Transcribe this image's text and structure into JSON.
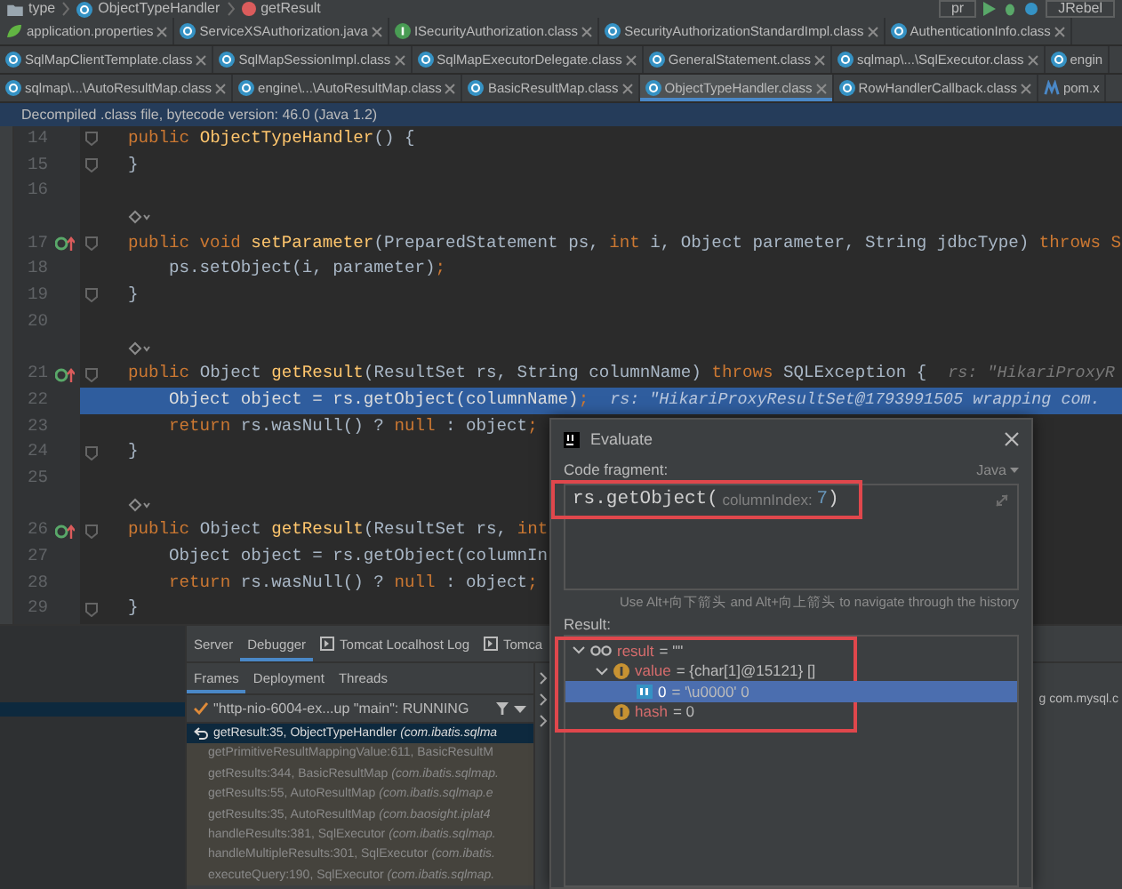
{
  "breadcrumb": [
    {
      "label": "type",
      "kind": "package"
    },
    {
      "label": "ObjectTypeHandler",
      "kind": "class"
    },
    {
      "label": "getResult",
      "kind": "method"
    }
  ],
  "toolbar": {
    "run_config": "pr",
    "plugin": "JRebel"
  },
  "editor_tabs": [
    [
      {
        "label": "application.properties",
        "kind": "properties",
        "selected": false,
        "closable": true
      },
      {
        "label": "ServiceXSAuthorization.java",
        "kind": "class",
        "selected": false,
        "closable": true
      },
      {
        "label": "ISecurityAuthorization.class",
        "kind": "interface",
        "selected": false,
        "closable": true
      },
      {
        "label": "SecurityAuthorizationStandardImpl.class",
        "kind": "class",
        "selected": false,
        "closable": true
      },
      {
        "label": "AuthenticationInfo.class",
        "kind": "class",
        "selected": false,
        "closable": true
      }
    ],
    [
      {
        "label": "SqlMapClientTemplate.class",
        "kind": "class",
        "selected": false,
        "closable": true
      },
      {
        "label": "SqlMapSessionImpl.class",
        "kind": "class",
        "selected": false,
        "closable": true
      },
      {
        "label": "SqlMapExecutorDelegate.class",
        "kind": "class",
        "selected": false,
        "closable": true
      },
      {
        "label": "GeneralStatement.class",
        "kind": "class",
        "selected": false,
        "closable": true
      },
      {
        "label": "sqlmap\\...\\SqlExecutor.class",
        "kind": "class",
        "selected": false,
        "closable": true
      },
      {
        "label": "engin",
        "kind": "class",
        "selected": false,
        "closable": false
      }
    ],
    [
      {
        "label": "sqlmap\\...\\AutoResultMap.class",
        "kind": "class",
        "selected": false,
        "closable": true
      },
      {
        "label": "engine\\...\\AutoResultMap.class",
        "kind": "class",
        "selected": false,
        "closable": true
      },
      {
        "label": "BasicResultMap.class",
        "kind": "class",
        "selected": false,
        "closable": true
      },
      {
        "label": "ObjectTypeHandler.class",
        "kind": "class",
        "selected": true,
        "closable": true
      },
      {
        "label": "RowHandlerCallback.class",
        "kind": "class",
        "selected": false,
        "closable": true
      },
      {
        "label": "pom.x",
        "kind": "maven",
        "selected": false,
        "closable": false
      }
    ]
  ],
  "banner": "Decompiled .class file, bytecode version: 46.0 (Java 1.2)",
  "code_lines": [
    {
      "kind": "code",
      "number": "14",
      "override": false,
      "fold": true,
      "current": false,
      "tokens": [
        {
          "text": "public ",
          "kind": "kw"
        },
        {
          "text": "ObjectTypeHandler",
          "kind": "fn"
        },
        {
          "text": "() {",
          "kind": "text"
        }
      ]
    },
    {
      "kind": "code",
      "number": "15",
      "override": false,
      "fold": true,
      "current": false,
      "tokens": [
        {
          "text": "}",
          "kind": "text"
        }
      ]
    },
    {
      "kind": "code",
      "number": "16",
      "override": false,
      "fold": false,
      "current": false
    },
    {
      "kind": "hint"
    },
    {
      "kind": "code",
      "number": "17",
      "override": true,
      "fold": true,
      "current": false,
      "tokens": [
        {
          "text": "public void ",
          "kind": "kw"
        },
        {
          "text": "setParameter",
          "kind": "fn"
        },
        {
          "text": "(PreparedStatement ps, ",
          "kind": "text"
        },
        {
          "text": "int ",
          "kind": "kw"
        },
        {
          "text": "i, Object parameter, String jdbcType) ",
          "kind": "text"
        },
        {
          "text": "throws S",
          "kind": "kw"
        }
      ]
    },
    {
      "kind": "code",
      "number": "18",
      "override": false,
      "fold": false,
      "current": false,
      "tokens": [
        {
          "text": "    ps.setObject(i, parameter)",
          "kind": "text"
        },
        {
          "text": ";",
          "kind": "kw"
        }
      ]
    },
    {
      "kind": "code",
      "number": "19",
      "override": false,
      "fold": true,
      "current": false,
      "tokens": [
        {
          "text": "}",
          "kind": "text"
        }
      ]
    },
    {
      "kind": "code",
      "number": "20",
      "override": false,
      "fold": false,
      "current": false
    },
    {
      "kind": "hint"
    },
    {
      "kind": "code",
      "number": "21",
      "override": true,
      "fold": true,
      "current": false,
      "tokens": [
        {
          "text": "public ",
          "kind": "kw"
        },
        {
          "text": "Object ",
          "kind": "text"
        },
        {
          "text": "getResult",
          "kind": "fn"
        },
        {
          "text": "(ResultSet rs, String columnName) ",
          "kind": "text"
        },
        {
          "text": "throws ",
          "kind": "kw"
        },
        {
          "text": "SQLException {",
          "kind": "text"
        }
      ],
      "inline_value": "rs: \"HikariProxyR"
    },
    {
      "kind": "code",
      "number": "22",
      "override": false,
      "fold": false,
      "current": true,
      "tokens": [
        {
          "text": "    Object object = rs.getObject(columnName)",
          "kind": "text"
        },
        {
          "text": ";",
          "kind": "kw"
        }
      ],
      "inline_value": "rs: \"HikariProxyResultSet@1793991505 wrapping com."
    },
    {
      "kind": "code",
      "number": "23",
      "override": false,
      "fold": false,
      "current": false,
      "tokens": [
        {
          "text": "    return ",
          "kind": "kw"
        },
        {
          "text": "rs.wasNull() ? ",
          "kind": "text"
        },
        {
          "text": "null",
          "kind": "kw"
        },
        {
          "text": " : object",
          "kind": "text"
        },
        {
          "text": ";",
          "kind": "kw"
        }
      ]
    },
    {
      "kind": "code",
      "number": "24",
      "override": false,
      "fold": true,
      "current": false,
      "tokens": [
        {
          "text": "}",
          "kind": "text"
        }
      ]
    },
    {
      "kind": "code",
      "number": "25",
      "override": false,
      "fold": false,
      "current": false
    },
    {
      "kind": "hint"
    },
    {
      "kind": "code",
      "number": "26",
      "override": true,
      "fold": true,
      "current": false,
      "tokens": [
        {
          "text": "public ",
          "kind": "kw"
        },
        {
          "text": "Object ",
          "kind": "text"
        },
        {
          "text": "getResult",
          "kind": "fn"
        },
        {
          "text": "(ResultSet rs, ",
          "kind": "text"
        },
        {
          "text": "int",
          "kind": "kw"
        }
      ]
    },
    {
      "kind": "code",
      "number": "27",
      "override": false,
      "fold": false,
      "current": false,
      "tokens": [
        {
          "text": "    Object object = rs.getObject(columnIn",
          "kind": "text"
        }
      ]
    },
    {
      "kind": "code",
      "number": "28",
      "override": false,
      "fold": false,
      "current": false,
      "tokens": [
        {
          "text": "    return ",
          "kind": "kw"
        },
        {
          "text": "rs.wasNull() ? ",
          "kind": "text"
        },
        {
          "text": "null",
          "kind": "kw"
        },
        {
          "text": " : object",
          "kind": "text"
        },
        {
          "text": ";",
          "kind": "kw"
        }
      ]
    },
    {
      "kind": "code",
      "number": "29",
      "override": false,
      "fold": true,
      "current": false,
      "tokens": [
        {
          "text": "}",
          "kind": "text"
        }
      ]
    }
  ],
  "debug_panel": {
    "tabs": [
      {
        "label": "Server",
        "selected": false,
        "console": false
      },
      {
        "label": "Debugger",
        "selected": true,
        "console": false
      },
      {
        "label": "Tomcat Localhost Log",
        "selected": false,
        "console": true
      },
      {
        "label": "Tomca",
        "selected": false,
        "console": true
      }
    ],
    "subtabs": [
      {
        "label": "Frames",
        "selected": true
      },
      {
        "label": "Deployment",
        "selected": false
      },
      {
        "label": "Threads",
        "selected": false
      }
    ],
    "thread": "\"http-nio-6004-ex...up \"main\": RUNNING",
    "frames": [
      {
        "method": "getResult:35, ObjectTypeHandler",
        "package": "(com.ibatis.sqlma",
        "selected": true
      },
      {
        "method": "getPrimitiveResultMappingValue:611, BasicResultM",
        "selected": false
      },
      {
        "method": "getResults:344, BasicResultMap",
        "package": "(com.ibatis.sqlmap.",
        "selected": false
      },
      {
        "method": "getResults:55, AutoResultMap",
        "package": "(com.ibatis.sqlmap.e",
        "selected": false
      },
      {
        "method": "getResults:35, AutoResultMap",
        "package": "(com.baosight.iplat4",
        "selected": false
      },
      {
        "method": "handleResults:381, SqlExecutor",
        "package": "(com.ibatis.sqlmap.",
        "selected": false
      },
      {
        "method": "handleMultipleResults:301, SqlExecutor",
        "package": "(com.ibatis.",
        "selected": false
      },
      {
        "method": "executeQuery:190, SqlExecutor",
        "package": "(com.ibatis.sqlmap.",
        "selected": false
      }
    ],
    "variables": [
      {
        "expanded": false
      },
      {
        "expanded": false,
        "value": "g com.mysql.c"
      },
      {
        "expanded": false
      }
    ]
  },
  "evaluate": {
    "title": "Evaluate",
    "code_label": "Code fragment:",
    "language": "Java",
    "highlighted": true,
    "expression": [
      {
        "text": "rs.getObject(",
        "kind": "code"
      },
      {
        "text": " columnIndex: ",
        "kind": "hint"
      },
      {
        "text": "7",
        "kind": "number"
      },
      {
        "text": ")",
        "kind": "code"
      }
    ],
    "history_hint": "Use Alt+向下箭头 and Alt+向上箭头 to navigate through the history",
    "result_label": "Result:",
    "result_highlighted": true,
    "tree": [
      {
        "name": "result",
        "value": "= \"\"",
        "kind": "watch",
        "expanded": true,
        "selected": false,
        "children": [
          {
            "name": "value",
            "value": "= {char[1]@15121} []",
            "kind": "field",
            "expanded": true,
            "selected": false,
            "children": [
              {
                "name": "0",
                "value": "= '\\u0000' 0",
                "kind": "array",
                "selected": true
              }
            ]
          },
          {
            "name": "hash",
            "value": "= 0",
            "kind": "field",
            "selected": false
          }
        ]
      }
    ]
  }
}
